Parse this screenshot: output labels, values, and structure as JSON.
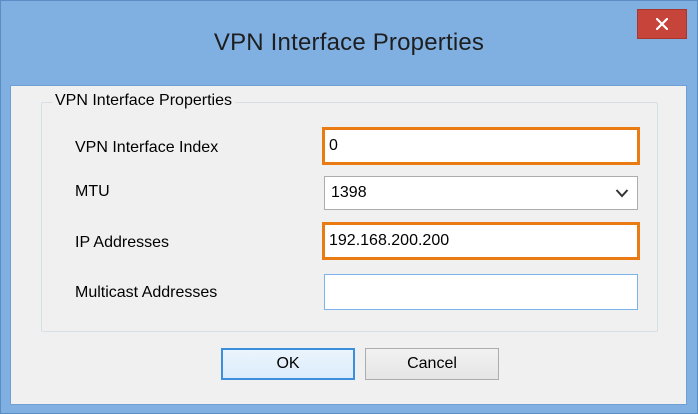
{
  "window": {
    "title": "VPN Interface Properties",
    "close_icon": "close-icon"
  },
  "group": {
    "legend": "VPN Interface Properties"
  },
  "fields": {
    "vpn_interface_index": {
      "label": "VPN Interface Index",
      "value": "0"
    },
    "mtu": {
      "label": "MTU",
      "value": "1398"
    },
    "ip_addresses": {
      "label": "IP Addresses",
      "value": "192.168.200.200"
    },
    "multicast_addresses": {
      "label": "Multicast Addresses",
      "value": ""
    }
  },
  "buttons": {
    "ok": "OK",
    "cancel": "Cancel"
  },
  "colors": {
    "title_bar": "#80b0e2",
    "close_button": "#c7443a",
    "highlight_border": "#ea7a12",
    "client_bg": "#f0f0f0"
  }
}
